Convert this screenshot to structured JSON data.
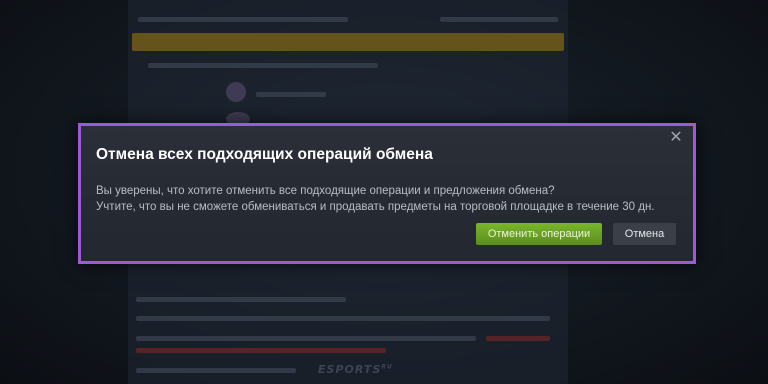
{
  "dialog": {
    "title": "Отмена всех подходящих операций обмена",
    "close_icon": "close-icon",
    "close_glyph": "✕",
    "message_line1": "Вы уверены, что хотите отменить все подходящие операции и предложения обмена?",
    "message_line2": "Учтите, что вы не сможете обмениваться и продавать предметы на торговой площадке в течение 30 дн.",
    "confirm_label": "Отменить операции",
    "cancel_label": "Отмена"
  },
  "watermark": {
    "text": "ESPORTS",
    "suffix": "RU"
  },
  "colors": {
    "highlight_border": "#9b5bd6",
    "dialog_bg": "#252a33",
    "confirm_green": "#6ea526",
    "cancel_bg": "#3a3f48"
  }
}
